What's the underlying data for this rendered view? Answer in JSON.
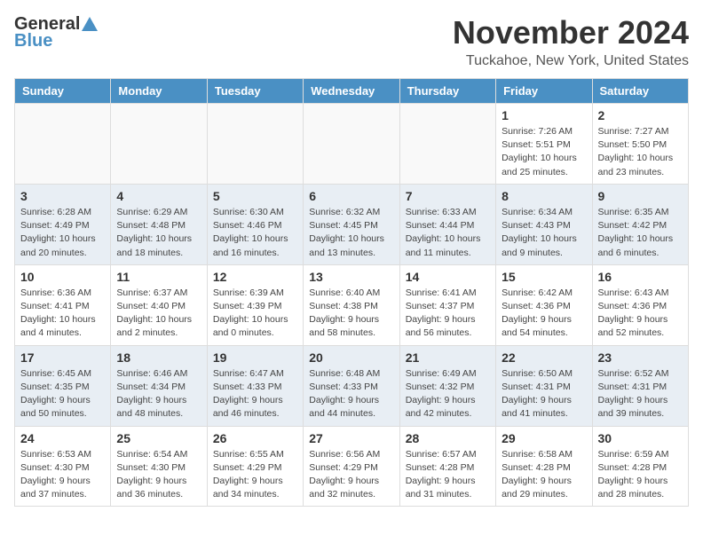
{
  "header": {
    "logo_general": "General",
    "logo_blue": "Blue",
    "month_title": "November 2024",
    "location": "Tuckahoe, New York, United States"
  },
  "days_of_week": [
    "Sunday",
    "Monday",
    "Tuesday",
    "Wednesday",
    "Thursday",
    "Friday",
    "Saturday"
  ],
  "weeks": [
    {
      "row_alt": false,
      "days": [
        {
          "num": "",
          "info": ""
        },
        {
          "num": "",
          "info": ""
        },
        {
          "num": "",
          "info": ""
        },
        {
          "num": "",
          "info": ""
        },
        {
          "num": "",
          "info": ""
        },
        {
          "num": "1",
          "info": "Sunrise: 7:26 AM\nSunset: 5:51 PM\nDaylight: 10 hours and 25 minutes."
        },
        {
          "num": "2",
          "info": "Sunrise: 7:27 AM\nSunset: 5:50 PM\nDaylight: 10 hours and 23 minutes."
        }
      ]
    },
    {
      "row_alt": true,
      "days": [
        {
          "num": "3",
          "info": "Sunrise: 6:28 AM\nSunset: 4:49 PM\nDaylight: 10 hours and 20 minutes."
        },
        {
          "num": "4",
          "info": "Sunrise: 6:29 AM\nSunset: 4:48 PM\nDaylight: 10 hours and 18 minutes."
        },
        {
          "num": "5",
          "info": "Sunrise: 6:30 AM\nSunset: 4:46 PM\nDaylight: 10 hours and 16 minutes."
        },
        {
          "num": "6",
          "info": "Sunrise: 6:32 AM\nSunset: 4:45 PM\nDaylight: 10 hours and 13 minutes."
        },
        {
          "num": "7",
          "info": "Sunrise: 6:33 AM\nSunset: 4:44 PM\nDaylight: 10 hours and 11 minutes."
        },
        {
          "num": "8",
          "info": "Sunrise: 6:34 AM\nSunset: 4:43 PM\nDaylight: 10 hours and 9 minutes."
        },
        {
          "num": "9",
          "info": "Sunrise: 6:35 AM\nSunset: 4:42 PM\nDaylight: 10 hours and 6 minutes."
        }
      ]
    },
    {
      "row_alt": false,
      "days": [
        {
          "num": "10",
          "info": "Sunrise: 6:36 AM\nSunset: 4:41 PM\nDaylight: 10 hours and 4 minutes."
        },
        {
          "num": "11",
          "info": "Sunrise: 6:37 AM\nSunset: 4:40 PM\nDaylight: 10 hours and 2 minutes."
        },
        {
          "num": "12",
          "info": "Sunrise: 6:39 AM\nSunset: 4:39 PM\nDaylight: 10 hours and 0 minutes."
        },
        {
          "num": "13",
          "info": "Sunrise: 6:40 AM\nSunset: 4:38 PM\nDaylight: 9 hours and 58 minutes."
        },
        {
          "num": "14",
          "info": "Sunrise: 6:41 AM\nSunset: 4:37 PM\nDaylight: 9 hours and 56 minutes."
        },
        {
          "num": "15",
          "info": "Sunrise: 6:42 AM\nSunset: 4:36 PM\nDaylight: 9 hours and 54 minutes."
        },
        {
          "num": "16",
          "info": "Sunrise: 6:43 AM\nSunset: 4:36 PM\nDaylight: 9 hours and 52 minutes."
        }
      ]
    },
    {
      "row_alt": true,
      "days": [
        {
          "num": "17",
          "info": "Sunrise: 6:45 AM\nSunset: 4:35 PM\nDaylight: 9 hours and 50 minutes."
        },
        {
          "num": "18",
          "info": "Sunrise: 6:46 AM\nSunset: 4:34 PM\nDaylight: 9 hours and 48 minutes."
        },
        {
          "num": "19",
          "info": "Sunrise: 6:47 AM\nSunset: 4:33 PM\nDaylight: 9 hours and 46 minutes."
        },
        {
          "num": "20",
          "info": "Sunrise: 6:48 AM\nSunset: 4:33 PM\nDaylight: 9 hours and 44 minutes."
        },
        {
          "num": "21",
          "info": "Sunrise: 6:49 AM\nSunset: 4:32 PM\nDaylight: 9 hours and 42 minutes."
        },
        {
          "num": "22",
          "info": "Sunrise: 6:50 AM\nSunset: 4:31 PM\nDaylight: 9 hours and 41 minutes."
        },
        {
          "num": "23",
          "info": "Sunrise: 6:52 AM\nSunset: 4:31 PM\nDaylight: 9 hours and 39 minutes."
        }
      ]
    },
    {
      "row_alt": false,
      "days": [
        {
          "num": "24",
          "info": "Sunrise: 6:53 AM\nSunset: 4:30 PM\nDaylight: 9 hours and 37 minutes."
        },
        {
          "num": "25",
          "info": "Sunrise: 6:54 AM\nSunset: 4:30 PM\nDaylight: 9 hours and 36 minutes."
        },
        {
          "num": "26",
          "info": "Sunrise: 6:55 AM\nSunset: 4:29 PM\nDaylight: 9 hours and 34 minutes."
        },
        {
          "num": "27",
          "info": "Sunrise: 6:56 AM\nSunset: 4:29 PM\nDaylight: 9 hours and 32 minutes."
        },
        {
          "num": "28",
          "info": "Sunrise: 6:57 AM\nSunset: 4:28 PM\nDaylight: 9 hours and 31 minutes."
        },
        {
          "num": "29",
          "info": "Sunrise: 6:58 AM\nSunset: 4:28 PM\nDaylight: 9 hours and 29 minutes."
        },
        {
          "num": "30",
          "info": "Sunrise: 6:59 AM\nSunset: 4:28 PM\nDaylight: 9 hours and 28 minutes."
        }
      ]
    }
  ]
}
